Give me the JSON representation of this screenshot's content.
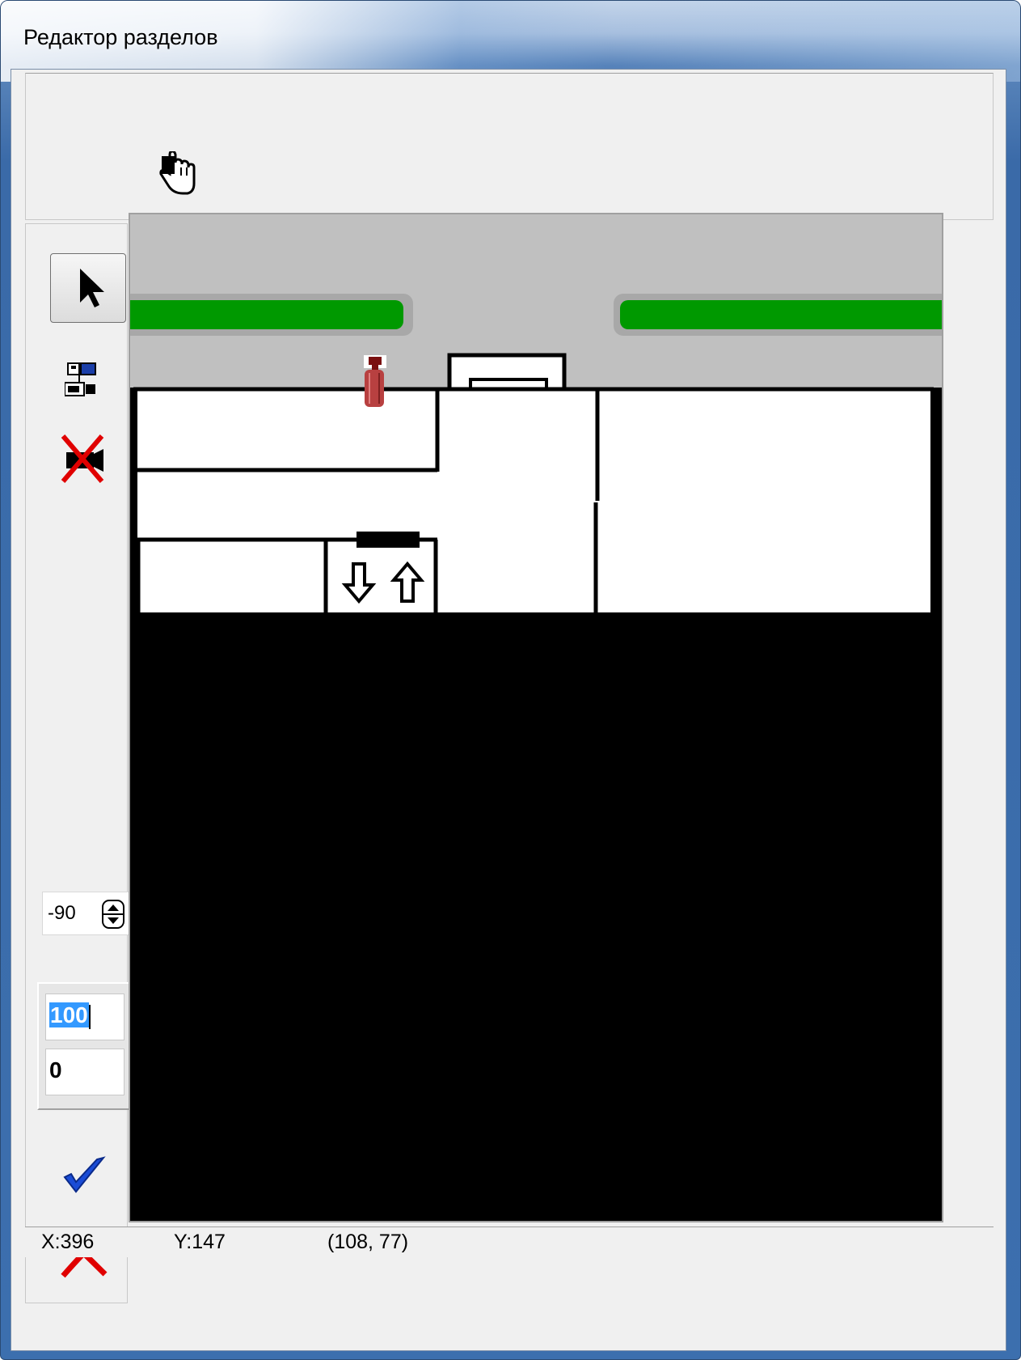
{
  "window": {
    "title": "Редактор разделов"
  },
  "toolbar": {
    "hand_tool": "hand-tool"
  },
  "side_tools": {
    "select": "arrow-pointer-icon",
    "add_device": "network-computers-icon",
    "remove_device": "remove-camera-icon",
    "angle_value": "-90",
    "num_top": "100",
    "num_bottom": "0",
    "ok": "checkmark-icon",
    "cancel": "red-x-icon"
  },
  "status": {
    "x": "X:396",
    "y": "Y:147",
    "coords": "(108, 77)"
  },
  "colors": {
    "road": "#c0c0c0",
    "lane": "#009900",
    "wall": "#000000",
    "room": "#ffffff",
    "device": "#b03030"
  }
}
